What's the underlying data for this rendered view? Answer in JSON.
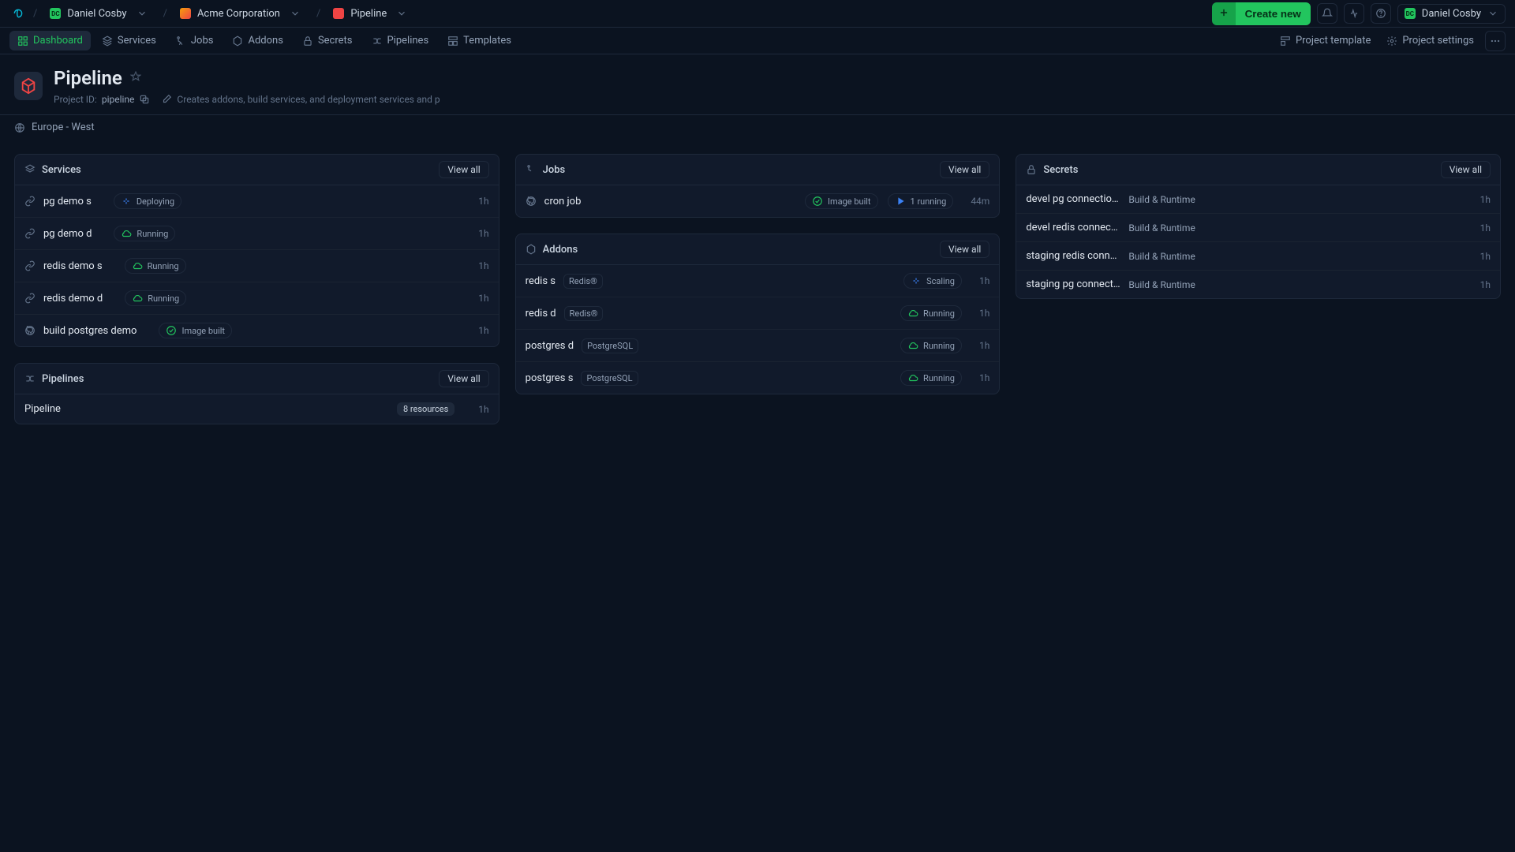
{
  "topbar": {
    "user_initials": "DC",
    "user_name": "Daniel Cosby",
    "org_name": "Acme Corporation",
    "project_name": "Pipeline",
    "create_label": "Create new"
  },
  "nav": {
    "items": [
      {
        "label": "Dashboard"
      },
      {
        "label": "Services"
      },
      {
        "label": "Jobs"
      },
      {
        "label": "Addons"
      },
      {
        "label": "Secrets"
      },
      {
        "label": "Pipelines"
      },
      {
        "label": "Templates"
      }
    ],
    "project_template": "Project template",
    "project_settings": "Project settings"
  },
  "header": {
    "title": "Pipeline",
    "project_id_label": "Project ID:",
    "project_id": "pipeline",
    "description": "Creates addons, build services, and deployment services and p",
    "region": "Europe - West"
  },
  "panels": {
    "services": {
      "title": "Services",
      "view_all": "View all",
      "items": [
        {
          "name": "pg demo s",
          "status": "Deploying",
          "status_kind": "deploying",
          "time": "1h"
        },
        {
          "name": "pg demo d",
          "status": "Running",
          "status_kind": "running",
          "time": "1h"
        },
        {
          "name": "redis demo s",
          "status": "Running",
          "status_kind": "running",
          "time": "1h"
        },
        {
          "name": "redis demo d",
          "status": "Running",
          "status_kind": "running",
          "time": "1h"
        },
        {
          "name": "build postgres demo",
          "status": "Image built",
          "status_kind": "imagebuilt",
          "time": "1h",
          "icon": "github"
        }
      ]
    },
    "pipelines": {
      "title": "Pipelines",
      "view_all": "View all",
      "items": [
        {
          "name": "Pipeline",
          "resources": "8 resources",
          "time": "1h"
        }
      ]
    },
    "jobs": {
      "title": "Jobs",
      "view_all": "View all",
      "items": [
        {
          "name": "cron job",
          "built_label": "Image built",
          "running_label": "1 running",
          "time": "44m"
        }
      ]
    },
    "addons": {
      "title": "Addons",
      "view_all": "View all",
      "items": [
        {
          "name": "redis s",
          "type": "Redis®",
          "status": "Scaling",
          "status_kind": "scaling",
          "time": "1h"
        },
        {
          "name": "redis d",
          "type": "Redis®",
          "status": "Running",
          "status_kind": "running",
          "time": "1h"
        },
        {
          "name": "postgres d",
          "type": "PostgreSQL",
          "status": "Running",
          "status_kind": "running",
          "time": "1h"
        },
        {
          "name": "postgres s",
          "type": "PostgreSQL",
          "status": "Running",
          "status_kind": "running",
          "time": "1h"
        }
      ]
    },
    "secrets": {
      "title": "Secrets",
      "view_all": "View all",
      "items": [
        {
          "name": "devel pg connection …",
          "scope": "Build & Runtime",
          "time": "1h"
        },
        {
          "name": "devel redis connecti…",
          "scope": "Build & Runtime",
          "time": "1h"
        },
        {
          "name": "staging redis connec…",
          "scope": "Build & Runtime",
          "time": "1h"
        },
        {
          "name": "staging pg connecti…",
          "scope": "Build & Runtime",
          "time": "1h"
        }
      ]
    }
  }
}
